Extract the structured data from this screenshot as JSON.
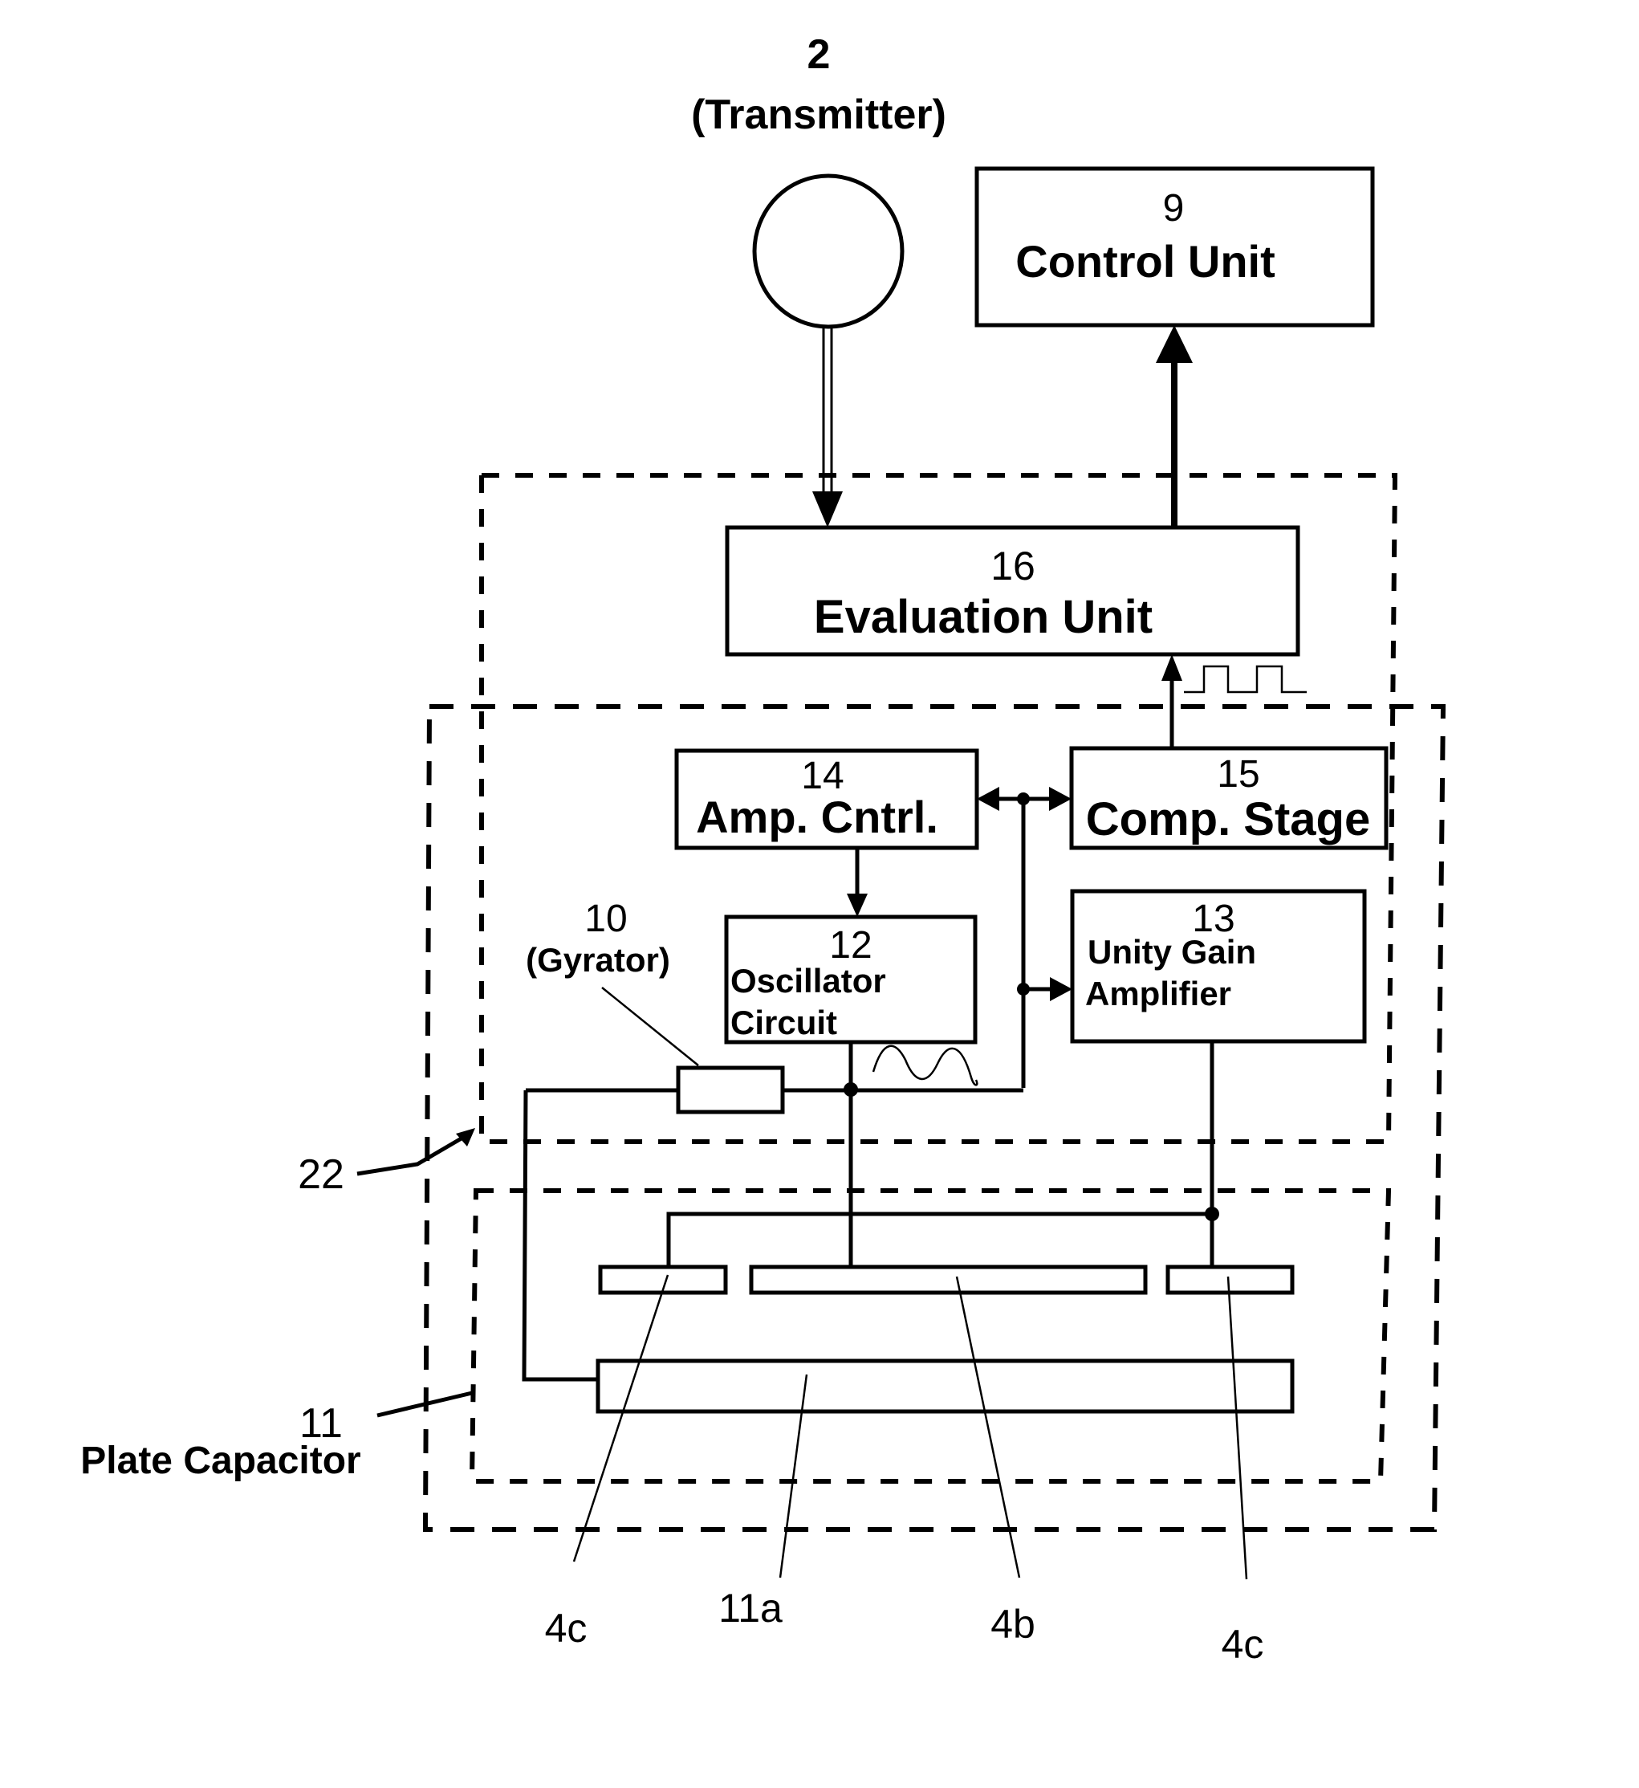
{
  "transmitter": {
    "number": "2",
    "label": "(Transmitter)"
  },
  "control_unit": {
    "number": "9",
    "label": "Control Unit"
  },
  "evaluation_unit": {
    "number": "16",
    "label": "Evaluation Unit"
  },
  "amp_control": {
    "number": "14",
    "label": "Amp. Cntrl."
  },
  "comp_stage": {
    "number": "15",
    "label": "Comp. Stage"
  },
  "oscillator": {
    "number": "12",
    "label_line1": "Oscillator",
    "label_line2": "Circuit"
  },
  "unity_gain": {
    "number": "13",
    "label_line1": "Unity Gain",
    "label_line2": "Amplifier"
  },
  "gyrator": {
    "number": "10",
    "label": "(Gyrator)"
  },
  "housing": {
    "number": "22"
  },
  "plate_capacitor": {
    "number": "11",
    "label": "Plate Capacitor"
  },
  "plate_labels": {
    "left_electrode": "4c",
    "bottom_plate": "11a",
    "center_electrode": "4b",
    "right_electrode": "4c"
  },
  "signals": {
    "square_wave": "square-wave-icon",
    "sine_wave": "sine-wave-icon"
  },
  "colors": {
    "ink": "#000000",
    "paper": "#ffffff"
  }
}
